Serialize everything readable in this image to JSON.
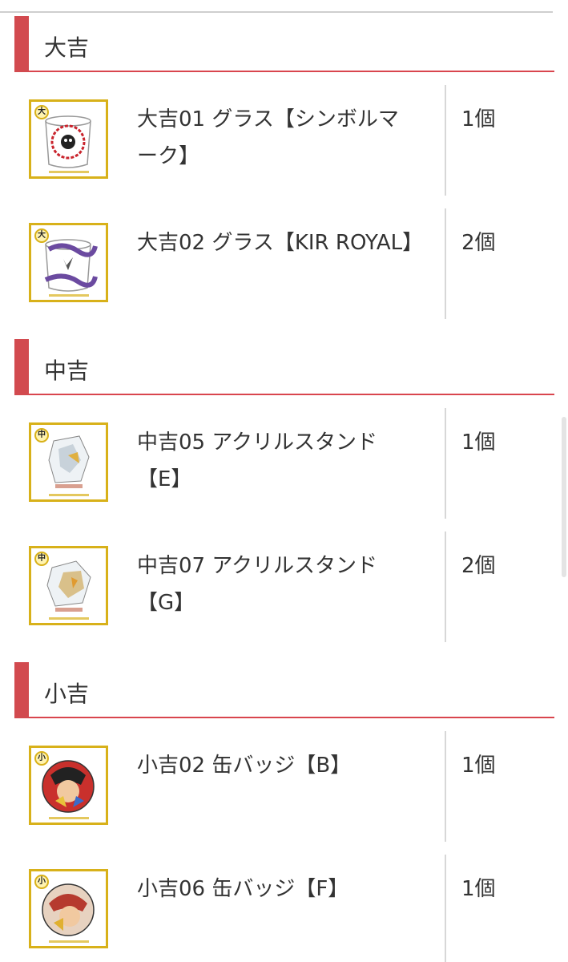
{
  "sections": [
    {
      "title": "大吉",
      "items": [
        {
          "name": "大吉01 グラス【シンボルマーク】",
          "qty": "1個",
          "tier": "大",
          "thumb": "glass-symbol-mark"
        },
        {
          "name": "大吉02 グラス【KIR ROYAL】",
          "qty": "2個",
          "tier": "大",
          "thumb": "glass-kir-royal"
        }
      ]
    },
    {
      "title": "中吉",
      "items": [
        {
          "name": "中吉05 アクリルスタンド【E】",
          "qty": "1個",
          "tier": "中",
          "thumb": "acrylic-stand"
        },
        {
          "name": "中吉07 アクリルスタンド【G】",
          "qty": "2個",
          "tier": "中",
          "thumb": "acrylic-stand"
        }
      ]
    },
    {
      "title": "小吉",
      "items": [
        {
          "name": "小吉02 缶バッジ【B】",
          "qty": "1個",
          "tier": "小",
          "thumb": "can-badge"
        },
        {
          "name": "小吉06 缶バッジ【F】",
          "qty": "1個",
          "tier": "小",
          "thumb": "can-badge"
        }
      ]
    }
  ],
  "colors": {
    "accent": "#d24a4f",
    "thumb_border": "#d8b11a",
    "divider": "#d7d7d7"
  }
}
